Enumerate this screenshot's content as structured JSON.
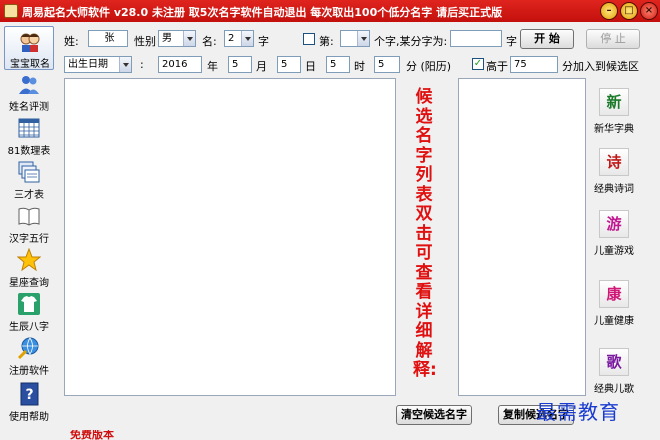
{
  "window": {
    "title": "周易起名大师软件 v28.0  未注册  取5次名字软件自动退出 每次取出100个低分名字 请后买正式版",
    "min": "–",
    "max": "□",
    "close": "×"
  },
  "sidebar": {
    "items": [
      {
        "label": "宝宝取名",
        "icon": "baby-faces-icon"
      },
      {
        "label": "姓名评测",
        "icon": "people-icon"
      },
      {
        "label": "81数理表",
        "icon": "grid-table-icon"
      },
      {
        "label": "三才表",
        "icon": "stacked-windows-icon"
      },
      {
        "label": "汉字五行",
        "icon": "open-book-icon"
      },
      {
        "label": "星座查询",
        "icon": "star-icon"
      },
      {
        "label": "生辰八字",
        "icon": "shirt-icon"
      },
      {
        "label": "注册软件",
        "icon": "globe-key-icon"
      },
      {
        "label": "使用帮助",
        "icon": "help-book-icon"
      }
    ]
  },
  "form": {
    "surname_label": "姓:",
    "surname_value": "张",
    "gender_label": "性别",
    "gender_value": "男",
    "name_label": "名:",
    "name_count": "2",
    "name_unit": "字",
    "nth_label": "第:",
    "nth_value": "",
    "fixed_label": "个字,某分字为:",
    "fixed_value": "",
    "fixed_unit": "字",
    "start_button": "开 始",
    "stop_button": "停 止",
    "date_type": "出生日期",
    "colon": ":",
    "year": "2016",
    "year_unit": "年",
    "month": "5",
    "month_unit": "月",
    "day": "5",
    "day_unit": "日",
    "hour": "5",
    "hour_unit": "时",
    "minute": "5",
    "minute_unit": "分 (阳历)",
    "above_checked": "✓",
    "above_label": "高于",
    "above_value": "75",
    "above_suffix": "分加入到候选区"
  },
  "candidate_note": "候选名字列表双击可查看详细解释:",
  "tools": [
    {
      "glyph": "新",
      "label": "新华字典",
      "color": "#1a7a2a",
      "icon": "xinhua-dictionary-icon"
    },
    {
      "glyph": "诗",
      "label": "经典诗词",
      "color": "#c01818",
      "icon": "poetry-icon"
    },
    {
      "glyph": "游",
      "label": "儿童游戏",
      "color": "#c01890",
      "icon": "kids-games-icon"
    },
    {
      "glyph": "康",
      "label": "儿童健康",
      "color": "#d01878",
      "icon": "kids-health-icon"
    },
    {
      "glyph": "歌",
      "label": "经典儿歌",
      "color": "#7a18a0",
      "icon": "kids-songs-icon"
    }
  ],
  "buttons": {
    "clear_candidates": "清空候选名字",
    "copy_candidates": "复制候选名字"
  },
  "watermark": "最需教育",
  "footer_fragment": "免费版本"
}
